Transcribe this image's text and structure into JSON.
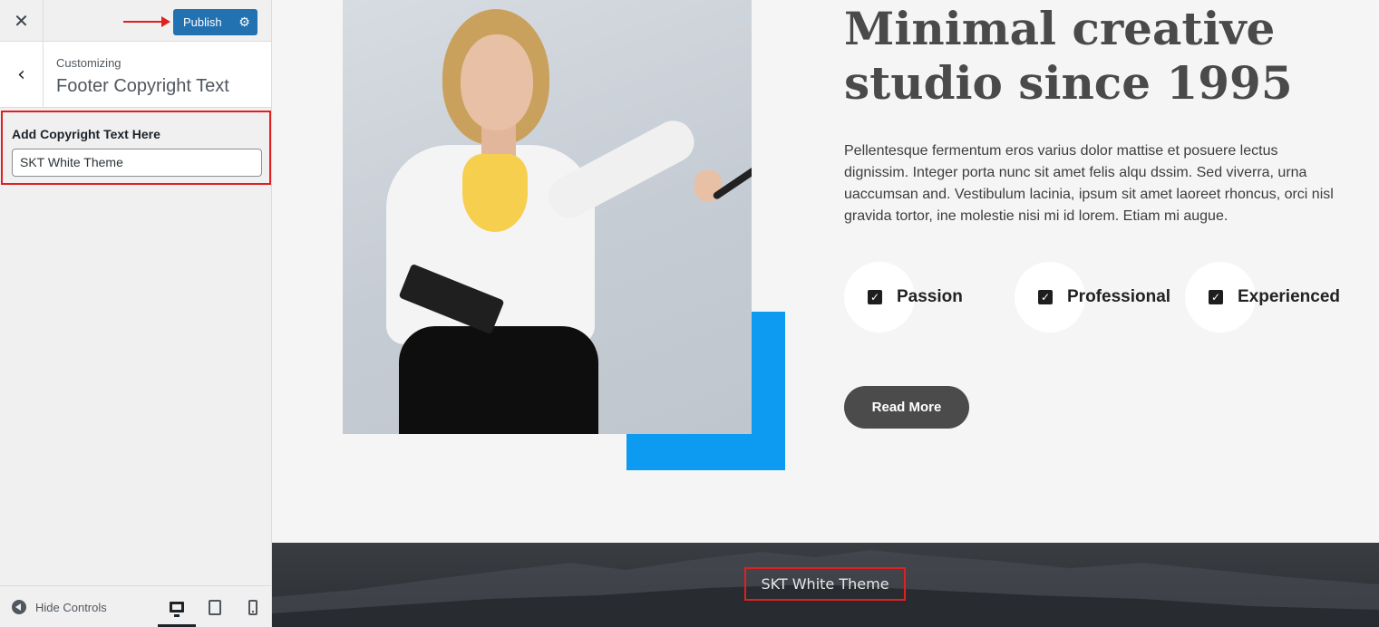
{
  "sidebar": {
    "close_icon": "close-icon",
    "publish_label": "Publish",
    "publish_gear_icon": "gear-icon",
    "crumb": "Customizing",
    "section_title": "Footer Copyright Text",
    "control_label": "Add Copyright Text Here",
    "control_value": "SKT White Theme",
    "hide_controls": "Hide Controls",
    "devices": [
      "desktop",
      "tablet",
      "mobile"
    ]
  },
  "preview": {
    "headline": "Minimal creative studio since 1995",
    "paragraph": "Pellentesque fermentum eros varius dolor mattise et posuere lectus dignissim. Integer porta nunc sit amet felis alqu dssim. Sed viverra, urna uaccumsan and. Vestibulum lacinia, ipsum sit amet laoreet rhoncus, orci nisl gravida tortor, ine molestie nisi mi id lorem. Etiam mi augue.",
    "features": [
      "Passion",
      "Professional",
      "Experienced"
    ],
    "read_more": "Read More",
    "footer_copyright": "SKT White Theme"
  },
  "colors": {
    "publish_blue": "#2271b1",
    "accent_blue": "#0d9bf2",
    "highlight_red": "#e02020",
    "button_dark": "#4b4b4b"
  }
}
